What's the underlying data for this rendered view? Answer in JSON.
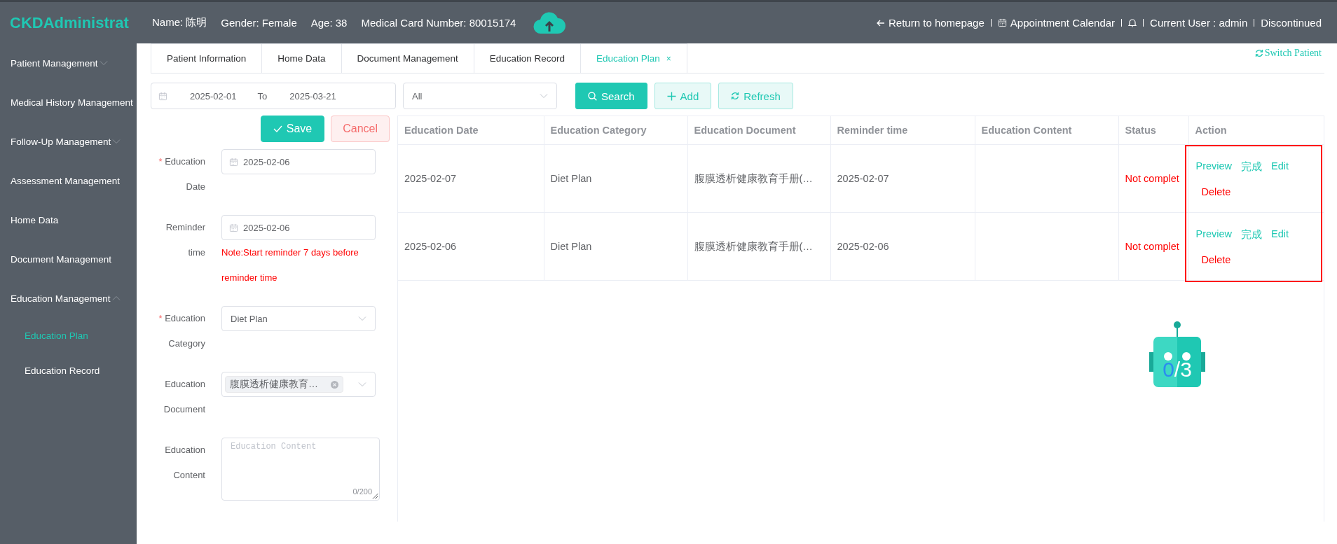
{
  "header": {
    "logo": "CKDAdministrat",
    "patient_fields": [
      "Name: 陈明",
      "Gender: Female",
      "Age: 38",
      "Medical Card Number: 80015174"
    ],
    "links": [
      {
        "kind": "back",
        "label": "Return to homepage"
      },
      {
        "kind": "calendar",
        "label": "Appointment Calendar"
      },
      {
        "kind": "bell"
      },
      {
        "kind": "user",
        "label": "Current User : admin"
      },
      {
        "kind": "logout",
        "label": "Discontinued"
      }
    ]
  },
  "sidebar": {
    "items": [
      {
        "kind": "group",
        "label": "Patient Management",
        "expanded": false
      },
      {
        "kind": "link",
        "label": "Medical History Management"
      },
      {
        "kind": "group",
        "label": "Follow-Up Management",
        "expanded": false
      },
      {
        "kind": "link",
        "label": "Assessment Management"
      },
      {
        "kind": "link",
        "label": "Home Data"
      },
      {
        "kind": "link",
        "label": "Document Management"
      },
      {
        "kind": "group",
        "label": "Education Management",
        "expanded": true,
        "children": [
          {
            "label": "Education Plan",
            "selected": true
          },
          {
            "label": "Education Record",
            "selected": false
          }
        ]
      }
    ]
  },
  "tabs": [
    {
      "label": "Patient Information",
      "selected": false
    },
    {
      "label": "Home Data",
      "selected": false
    },
    {
      "label": "Document Management",
      "selected": false
    },
    {
      "label": "Education Record",
      "selected": false
    },
    {
      "label": "Education Plan",
      "selected": true,
      "close": "×"
    }
  ],
  "switch_patient": "Switch Patient",
  "filters": {
    "date_from": "2025-02-01",
    "separator": "To",
    "date_to": "2025-03-21",
    "status_select": "All",
    "buttons": [
      {
        "kind": "search",
        "primary": true,
        "label": "Search"
      },
      {
        "kind": "add",
        "primary": false,
        "label": "Add"
      },
      {
        "kind": "refresh",
        "primary": false,
        "label": "Refresh"
      }
    ]
  },
  "form": {
    "buttons": [
      {
        "kind": "save",
        "label": "Save"
      },
      {
        "kind": "cancel",
        "label": "Cancel"
      }
    ],
    "fields": [
      {
        "kind": "date",
        "label": "Education Date",
        "required_mark": "*",
        "value": "2025-02-06"
      },
      {
        "kind": "date",
        "label": "Reminder time",
        "value": "2025-02-06",
        "note": "Note:Start reminder 7 days before reminder time"
      },
      {
        "kind": "select",
        "label": "Education Category",
        "required_mark": "*",
        "value": "Diet Plan"
      },
      {
        "kind": "tags",
        "label": "Education Document",
        "tags": [
          "腹膜透析健康教育…"
        ]
      },
      {
        "kind": "textarea",
        "label": "Education Content",
        "placeholder": "Education Content",
        "counter": "0/200"
      }
    ]
  },
  "table": {
    "columns": [
      "Education Date",
      "Education Category",
      "Education Document",
      "Reminder time",
      "Education Content",
      "Status",
      "Action"
    ],
    "rows": [
      {
        "cells": [
          "2025-02-07",
          "Diet Plan",
          "腹膜透析健康教育手册(…",
          "2025-02-07",
          ""
        ],
        "status": "Not complet",
        "actions": [
          {
            "label": "Preview",
            "danger": false
          },
          {
            "label": "完成",
            "danger": false
          },
          {
            "label": "Edit",
            "danger": false
          },
          {
            "label": "Delete",
            "danger": true
          }
        ]
      },
      {
        "cells": [
          "2025-02-06",
          "Diet Plan",
          "腹膜透析健康教育手册(…",
          "2025-02-06",
          ""
        ],
        "status": "Not complet",
        "actions": [
          {
            "label": "Preview",
            "danger": false
          },
          {
            "label": "完成",
            "danger": false
          },
          {
            "label": "Edit",
            "danger": false
          },
          {
            "label": "Delete",
            "danger": true
          }
        ]
      }
    ],
    "highlight_actions": true
  },
  "robot": {
    "done": "0",
    "total": "/3"
  }
}
